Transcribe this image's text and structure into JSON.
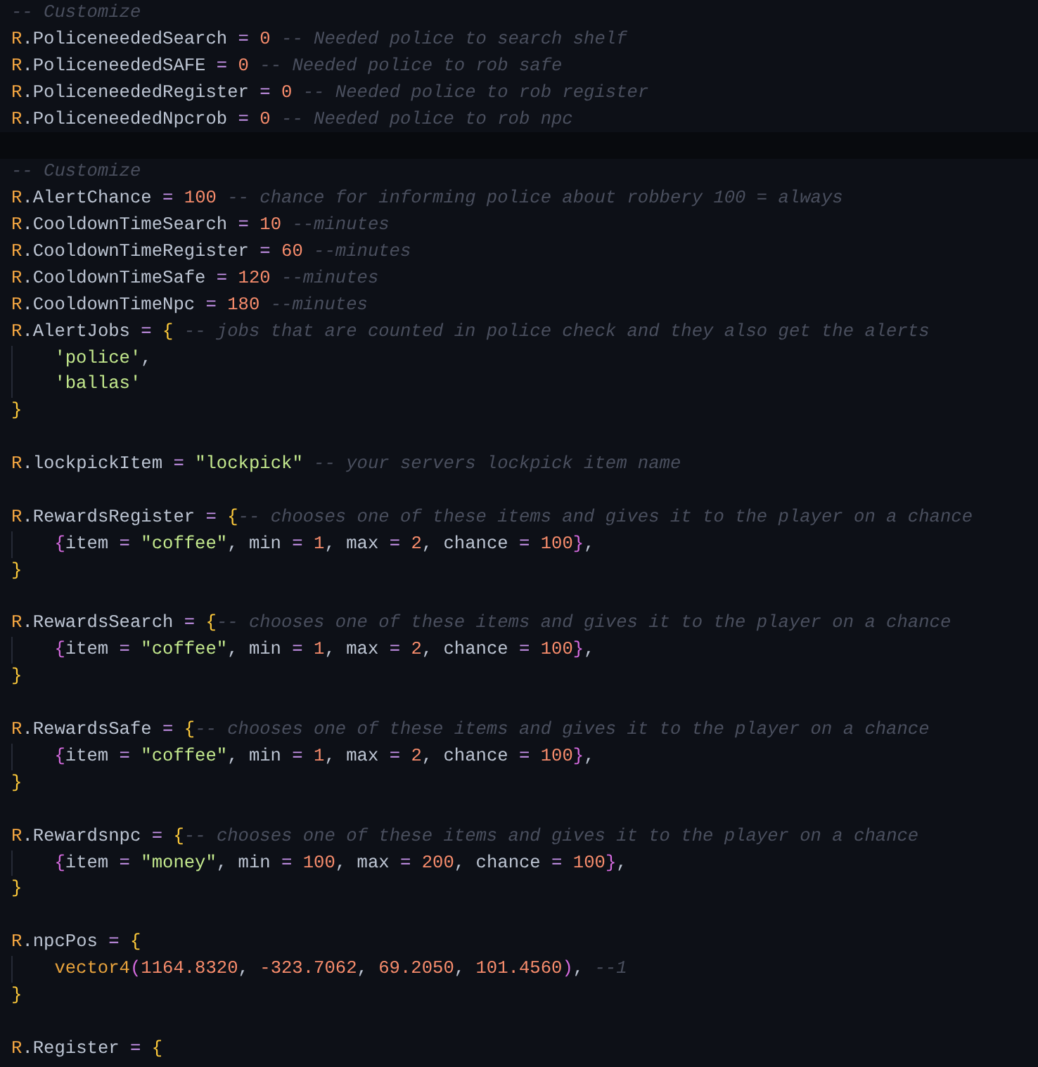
{
  "editor": {
    "lines": [
      {
        "current": false,
        "tokens": [
          {
            "kind": "comment",
            "text": "-- Customize"
          }
        ]
      },
      {
        "current": false,
        "tokens": [
          {
            "kind": "ns",
            "text": "R"
          },
          {
            "kind": "plain",
            "text": ".PoliceneededSearch"
          },
          {
            "kind": "op",
            "text": " = "
          },
          {
            "kind": "num",
            "text": "0"
          },
          {
            "kind": "comment",
            "text": " -- Needed police to search shelf"
          }
        ]
      },
      {
        "current": false,
        "tokens": [
          {
            "kind": "ns",
            "text": "R"
          },
          {
            "kind": "plain",
            "text": ".PoliceneededSAFE"
          },
          {
            "kind": "op",
            "text": " = "
          },
          {
            "kind": "num",
            "text": "0"
          },
          {
            "kind": "comment",
            "text": " -- Needed police to rob safe"
          }
        ]
      },
      {
        "current": false,
        "tokens": [
          {
            "kind": "ns",
            "text": "R"
          },
          {
            "kind": "plain",
            "text": ".PoliceneededRegister"
          },
          {
            "kind": "op",
            "text": " = "
          },
          {
            "kind": "num",
            "text": "0"
          },
          {
            "kind": "comment",
            "text": " -- Needed police to rob register"
          }
        ]
      },
      {
        "current": false,
        "tokens": [
          {
            "kind": "ns",
            "text": "R"
          },
          {
            "kind": "plain",
            "text": ".PoliceneededNpcrob"
          },
          {
            "kind": "op",
            "text": " = "
          },
          {
            "kind": "num",
            "text": "0"
          },
          {
            "kind": "comment",
            "text": " -- Needed police to rob npc"
          }
        ]
      },
      {
        "current": true
      },
      {
        "current": false,
        "tokens": [
          {
            "kind": "comment",
            "text": "-- Customize"
          }
        ]
      },
      {
        "current": false,
        "tokens": [
          {
            "kind": "ns",
            "text": "R"
          },
          {
            "kind": "plain",
            "text": ".AlertChance"
          },
          {
            "kind": "op",
            "text": " = "
          },
          {
            "kind": "num",
            "text": "100"
          },
          {
            "kind": "comment",
            "text": " -- chance for informing police about robbery 100 = always"
          }
        ]
      },
      {
        "current": false,
        "tokens": [
          {
            "kind": "ns",
            "text": "R"
          },
          {
            "kind": "plain",
            "text": ".CooldownTimeSearch"
          },
          {
            "kind": "op",
            "text": " = "
          },
          {
            "kind": "num",
            "text": "10"
          },
          {
            "kind": "comment",
            "text": " --minutes"
          }
        ]
      },
      {
        "current": false,
        "tokens": [
          {
            "kind": "ns",
            "text": "R"
          },
          {
            "kind": "plain",
            "text": ".CooldownTimeRegister"
          },
          {
            "kind": "op",
            "text": " = "
          },
          {
            "kind": "num",
            "text": "60"
          },
          {
            "kind": "comment",
            "text": " --minutes"
          }
        ]
      },
      {
        "current": false,
        "tokens": [
          {
            "kind": "ns",
            "text": "R"
          },
          {
            "kind": "plain",
            "text": ".CooldownTimeSafe"
          },
          {
            "kind": "op",
            "text": " = "
          },
          {
            "kind": "num",
            "text": "120"
          },
          {
            "kind": "comment",
            "text": " --minutes"
          }
        ]
      },
      {
        "current": false,
        "tokens": [
          {
            "kind": "ns",
            "text": "R"
          },
          {
            "kind": "plain",
            "text": ".CooldownTimeNpc"
          },
          {
            "kind": "op",
            "text": " = "
          },
          {
            "kind": "num",
            "text": "180"
          },
          {
            "kind": "comment",
            "text": " --minutes"
          }
        ]
      },
      {
        "current": false,
        "tokens": [
          {
            "kind": "ns",
            "text": "R"
          },
          {
            "kind": "plain",
            "text": ".AlertJobs"
          },
          {
            "kind": "op",
            "text": " = "
          },
          {
            "kind": "brace",
            "text": "{"
          },
          {
            "kind": "comment",
            "text": " -- jobs that are counted in police check and they also get the alerts"
          }
        ],
        "children": [
          {
            "current": false,
            "tokens": [
              {
                "kind": "string",
                "text": "'police'"
              },
              {
                "kind": "plain",
                "text": ","
              }
            ]
          },
          {
            "current": false,
            "tokens": [
              {
                "kind": "string",
                "text": "'ballas'"
              }
            ]
          }
        ]
      },
      {
        "current": false,
        "tokens": [
          {
            "kind": "brace",
            "text": "}"
          }
        ]
      },
      {
        "current": false
      },
      {
        "current": false,
        "tokens": [
          {
            "kind": "ns",
            "text": "R"
          },
          {
            "kind": "plain",
            "text": ".lockpickItem"
          },
          {
            "kind": "op",
            "text": " = "
          },
          {
            "kind": "string",
            "text": "\"lockpick\""
          },
          {
            "kind": "comment",
            "text": " -- your servers lockpick item name"
          }
        ]
      },
      {
        "current": false
      },
      {
        "current": false,
        "tokens": [
          {
            "kind": "ns",
            "text": "R"
          },
          {
            "kind": "plain",
            "text": ".RewardsRegister"
          },
          {
            "kind": "op",
            "text": " = "
          },
          {
            "kind": "brace",
            "text": "{"
          },
          {
            "kind": "comment",
            "text": "-- chooses one of these items and gives it to the player on a chance"
          }
        ],
        "children": [
          {
            "current": false,
            "tokens": [
              {
                "kind": "brace2",
                "text": "{"
              },
              {
                "kind": "plain",
                "text": "item"
              },
              {
                "kind": "op",
                "text": " = "
              },
              {
                "kind": "string",
                "text": "\"coffee\""
              },
              {
                "kind": "plain",
                "text": ", min"
              },
              {
                "kind": "op",
                "text": " = "
              },
              {
                "kind": "num",
                "text": "1"
              },
              {
                "kind": "plain",
                "text": ", max"
              },
              {
                "kind": "op",
                "text": " = "
              },
              {
                "kind": "num",
                "text": "2"
              },
              {
                "kind": "plain",
                "text": ", chance"
              },
              {
                "kind": "op",
                "text": " = "
              },
              {
                "kind": "num",
                "text": "100"
              },
              {
                "kind": "brace2",
                "text": "}"
              },
              {
                "kind": "plain",
                "text": ","
              }
            ]
          }
        ]
      },
      {
        "current": false,
        "tokens": [
          {
            "kind": "brace",
            "text": "}"
          }
        ]
      },
      {
        "current": false
      },
      {
        "current": false,
        "tokens": [
          {
            "kind": "ns",
            "text": "R"
          },
          {
            "kind": "plain",
            "text": ".RewardsSearch"
          },
          {
            "kind": "op",
            "text": " = "
          },
          {
            "kind": "brace",
            "text": "{"
          },
          {
            "kind": "comment",
            "text": "-- chooses one of these items and gives it to the player on a chance"
          }
        ],
        "children": [
          {
            "current": false,
            "tokens": [
              {
                "kind": "brace2",
                "text": "{"
              },
              {
                "kind": "plain",
                "text": "item"
              },
              {
                "kind": "op",
                "text": " = "
              },
              {
                "kind": "string",
                "text": "\"coffee\""
              },
              {
                "kind": "plain",
                "text": ", min"
              },
              {
                "kind": "op",
                "text": " = "
              },
              {
                "kind": "num",
                "text": "1"
              },
              {
                "kind": "plain",
                "text": ", max"
              },
              {
                "kind": "op",
                "text": " = "
              },
              {
                "kind": "num",
                "text": "2"
              },
              {
                "kind": "plain",
                "text": ", chance"
              },
              {
                "kind": "op",
                "text": " = "
              },
              {
                "kind": "num",
                "text": "100"
              },
              {
                "kind": "brace2",
                "text": "}"
              },
              {
                "kind": "plain",
                "text": ","
              }
            ]
          }
        ]
      },
      {
        "current": false,
        "tokens": [
          {
            "kind": "brace",
            "text": "}"
          }
        ]
      },
      {
        "current": false
      },
      {
        "current": false,
        "tokens": [
          {
            "kind": "ns",
            "text": "R"
          },
          {
            "kind": "plain",
            "text": ".RewardsSafe"
          },
          {
            "kind": "op",
            "text": " = "
          },
          {
            "kind": "brace",
            "text": "{"
          },
          {
            "kind": "comment",
            "text": "-- chooses one of these items and gives it to the player on a chance"
          }
        ],
        "children": [
          {
            "current": false,
            "tokens": [
              {
                "kind": "brace2",
                "text": "{"
              },
              {
                "kind": "plain",
                "text": "item"
              },
              {
                "kind": "op",
                "text": " = "
              },
              {
                "kind": "string",
                "text": "\"coffee\""
              },
              {
                "kind": "plain",
                "text": ", min"
              },
              {
                "kind": "op",
                "text": " = "
              },
              {
                "kind": "num",
                "text": "1"
              },
              {
                "kind": "plain",
                "text": ", max"
              },
              {
                "kind": "op",
                "text": " = "
              },
              {
                "kind": "num",
                "text": "2"
              },
              {
                "kind": "plain",
                "text": ", chance"
              },
              {
                "kind": "op",
                "text": " = "
              },
              {
                "kind": "num",
                "text": "100"
              },
              {
                "kind": "brace2",
                "text": "}"
              },
              {
                "kind": "plain",
                "text": ","
              }
            ]
          }
        ]
      },
      {
        "current": false,
        "tokens": [
          {
            "kind": "brace",
            "text": "}"
          }
        ]
      },
      {
        "current": false
      },
      {
        "current": false,
        "tokens": [
          {
            "kind": "ns",
            "text": "R"
          },
          {
            "kind": "plain",
            "text": ".Rewardsnpc"
          },
          {
            "kind": "op",
            "text": " = "
          },
          {
            "kind": "brace",
            "text": "{"
          },
          {
            "kind": "comment",
            "text": "-- chooses one of these items and gives it to the player on a chance"
          }
        ],
        "children": [
          {
            "current": false,
            "tokens": [
              {
                "kind": "brace2",
                "text": "{"
              },
              {
                "kind": "plain",
                "text": "item"
              },
              {
                "kind": "op",
                "text": " = "
              },
              {
                "kind": "string",
                "text": "\"money\""
              },
              {
                "kind": "plain",
                "text": ", min"
              },
              {
                "kind": "op",
                "text": " = "
              },
              {
                "kind": "num",
                "text": "100"
              },
              {
                "kind": "plain",
                "text": ", max"
              },
              {
                "kind": "op",
                "text": " = "
              },
              {
                "kind": "num",
                "text": "200"
              },
              {
                "kind": "plain",
                "text": ", chance"
              },
              {
                "kind": "op",
                "text": " = "
              },
              {
                "kind": "num",
                "text": "100"
              },
              {
                "kind": "brace2",
                "text": "}"
              },
              {
                "kind": "plain",
                "text": ","
              }
            ]
          }
        ]
      },
      {
        "current": false,
        "tokens": [
          {
            "kind": "brace",
            "text": "}"
          }
        ]
      },
      {
        "current": false
      },
      {
        "current": false,
        "tokens": [
          {
            "kind": "ns",
            "text": "R"
          },
          {
            "kind": "plain",
            "text": ".npcPos"
          },
          {
            "kind": "op",
            "text": " = "
          },
          {
            "kind": "brace",
            "text": "{"
          }
        ],
        "children": [
          {
            "current": false,
            "tokens": [
              {
                "kind": "func",
                "text": "vector4"
              },
              {
                "kind": "brace2",
                "text": "("
              },
              {
                "kind": "num",
                "text": "1164.8320"
              },
              {
                "kind": "plain",
                "text": ", "
              },
              {
                "kind": "num",
                "text": "-323.7062"
              },
              {
                "kind": "plain",
                "text": ", "
              },
              {
                "kind": "num",
                "text": "69.2050"
              },
              {
                "kind": "plain",
                "text": ", "
              },
              {
                "kind": "num",
                "text": "101.4560"
              },
              {
                "kind": "brace2",
                "text": ")"
              },
              {
                "kind": "plain",
                "text": ", "
              },
              {
                "kind": "comment",
                "text": "--1"
              }
            ]
          }
        ]
      },
      {
        "current": false,
        "tokens": [
          {
            "kind": "brace",
            "text": "}"
          }
        ]
      },
      {
        "current": false
      },
      {
        "current": false,
        "tokens": [
          {
            "kind": "ns",
            "text": "R"
          },
          {
            "kind": "plain",
            "text": ".Register"
          },
          {
            "kind": "op",
            "text": " = "
          },
          {
            "kind": "brace",
            "text": "{"
          }
        ]
      }
    ]
  }
}
